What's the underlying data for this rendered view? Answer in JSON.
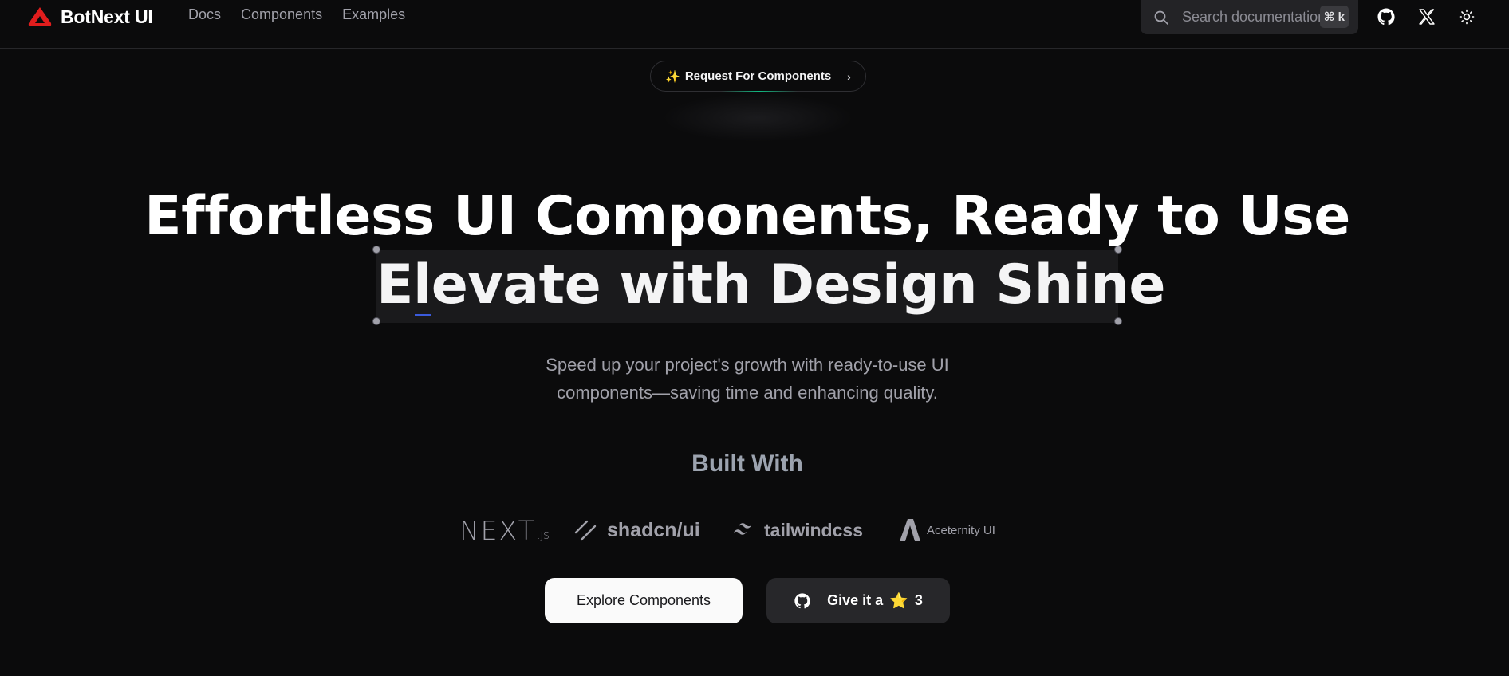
{
  "navbar": {
    "brand": "BotNext UI",
    "links": [
      "Docs",
      "Components",
      "Examples"
    ],
    "search": {
      "placeholder": "Search documentation",
      "shortcut": "⌘ k"
    },
    "icons": [
      "github-icon",
      "x-twitter-icon",
      "theme-toggle-sun-icon"
    ]
  },
  "announcement": {
    "emoji": "✨",
    "label": "Request For Components",
    "chevron": "›"
  },
  "hero": {
    "title_line1": "Effortless UI Components, Ready to Use",
    "title_line2": "Elevate with Design Shine",
    "subtitle_line1": "Speed up your project's growth with ready-to-use UI",
    "subtitle_line2": "components—saving time and enhancing quality."
  },
  "built_with": {
    "heading": "Built With",
    "logos": {
      "next_main": "NEXT",
      "next_sub": ".JS",
      "shadcn": "shadcn/ui",
      "tailwind": "tailwindcss",
      "aceternity": "Aceternity UI"
    }
  },
  "cta": {
    "primary": "Explore Components",
    "secondary_prefix": "Give it a",
    "secondary_star": "⭐",
    "secondary_count": "3"
  },
  "colors": {
    "background": "#0b0b0c",
    "brand_red": "#e11d1d",
    "accent_green": "#10b981",
    "star_yellow": "#facc15"
  }
}
